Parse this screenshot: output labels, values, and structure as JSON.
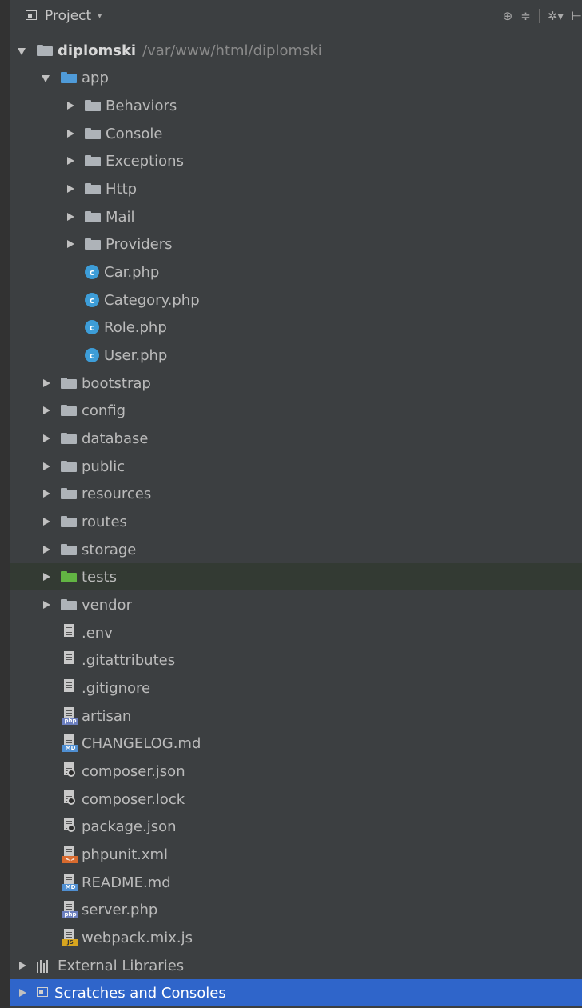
{
  "header": {
    "title": "Project",
    "caret": "▾",
    "tools": [
      "⊕",
      "≑",
      "|",
      "✲▾",
      "⊢"
    ]
  },
  "tree": {
    "root": {
      "label": "diplomski",
      "path": "/var/www/html/diplomski"
    },
    "app": {
      "label": "app",
      "folders": [
        "Behaviors",
        "Console",
        "Exceptions",
        "Http",
        "Mail",
        "Providers"
      ],
      "classes": [
        "Car.php",
        "Category.php",
        "Role.php",
        "User.php"
      ],
      "class_badge": "c"
    },
    "folders": [
      "bootstrap",
      "config",
      "database",
      "public",
      "resources",
      "routes",
      "storage",
      "tests",
      "vendor"
    ],
    "files": [
      {
        "name": ".env",
        "icon": "text-file-icon",
        "badge": ""
      },
      {
        "name": ".gitattributes",
        "icon": "text-file-icon",
        "badge": ""
      },
      {
        "name": ".gitignore",
        "icon": "text-file-icon",
        "badge": ""
      },
      {
        "name": "artisan",
        "icon": "php-file-icon",
        "badge": "php"
      },
      {
        "name": "CHANGELOG.md",
        "icon": "markdown-file-icon",
        "badge": "MD"
      },
      {
        "name": "composer.json",
        "icon": "json-file-icon",
        "badge": ""
      },
      {
        "name": "composer.lock",
        "icon": "json-file-icon",
        "badge": ""
      },
      {
        "name": "package.json",
        "icon": "json-file-icon",
        "badge": ""
      },
      {
        "name": "phpunit.xml",
        "icon": "xml-file-icon",
        "badge": "<>"
      },
      {
        "name": "README.md",
        "icon": "markdown-file-icon",
        "badge": "MD"
      },
      {
        "name": "server.php",
        "icon": "php-file-icon",
        "badge": "php"
      },
      {
        "name": "webpack.mix.js",
        "icon": "js-file-icon",
        "badge": "JS"
      }
    ],
    "external_libraries": "External Libraries",
    "scratches": "Scratches and Consoles"
  },
  "colors": {
    "background": "#3c3f41",
    "selection": "#2f65ca",
    "highlight": "#333a33",
    "folder": "#aeb3b8",
    "source_folder": "#4f9bd9",
    "test_folder": "#62b543",
    "class_icon": "#3d9dd8"
  }
}
